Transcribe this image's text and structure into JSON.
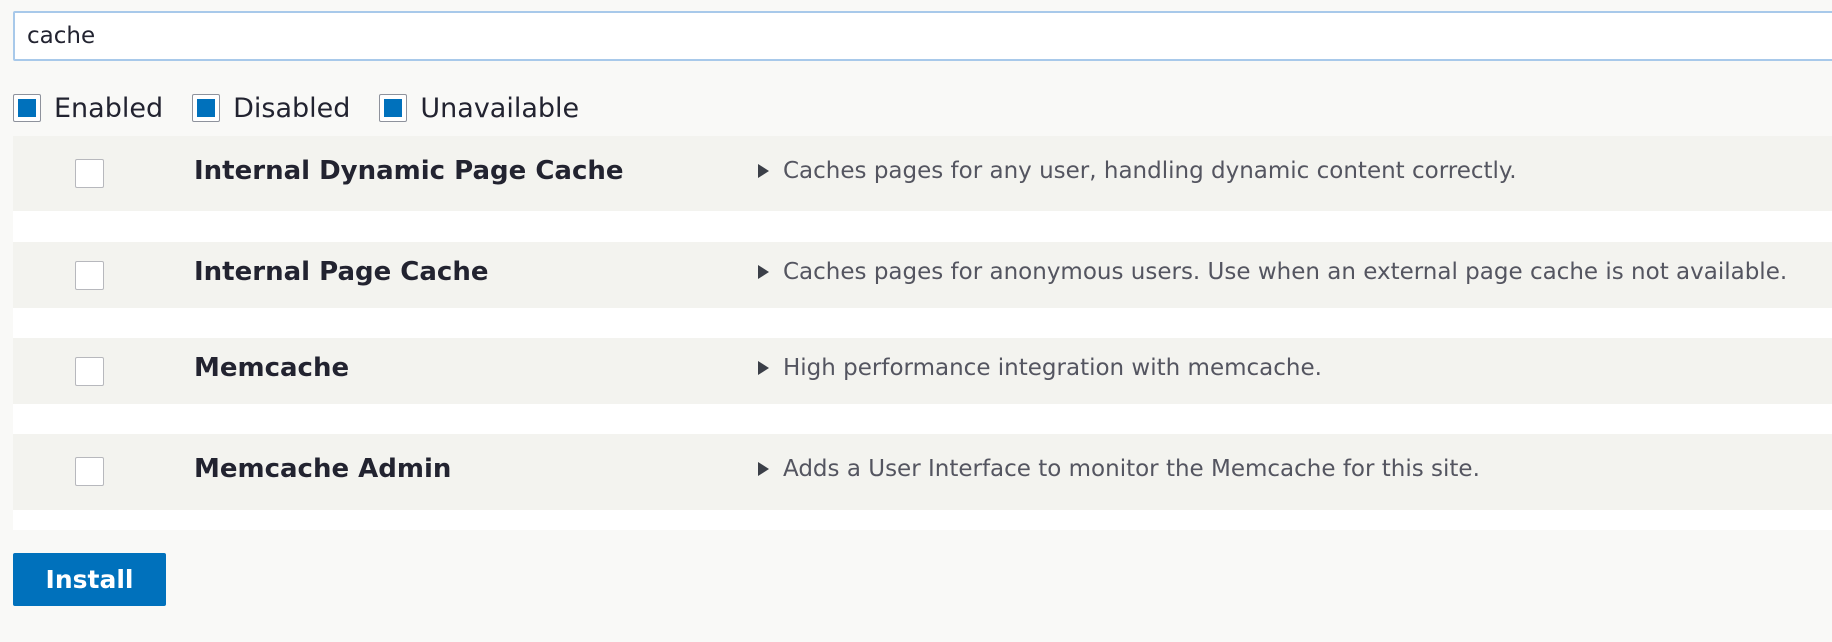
{
  "search": {
    "value": "cache"
  },
  "filters": [
    {
      "label": "Enabled",
      "checked": true
    },
    {
      "label": "Disabled",
      "checked": true
    },
    {
      "label": "Unavailable",
      "checked": true
    }
  ],
  "modules": [
    {
      "name": "Internal Dynamic Page Cache",
      "description": "Caches pages for any user, handling dynamic content correctly.",
      "checked": false
    },
    {
      "name": "Internal Page Cache",
      "description": "Caches pages for anonymous users. Use when an external page cache is not available.",
      "checked": false
    },
    {
      "name": "Memcache",
      "description": "High performance integration with memcache.",
      "checked": false
    },
    {
      "name": "Memcache Admin",
      "description": "Adds a User Interface to monitor the Memcache for this site.",
      "checked": false
    }
  ],
  "actions": {
    "install_label": "Install"
  },
  "colors": {
    "accent": "#0071bc",
    "row_background": "#f3f3ef",
    "page_background": "#f9f9f7"
  }
}
